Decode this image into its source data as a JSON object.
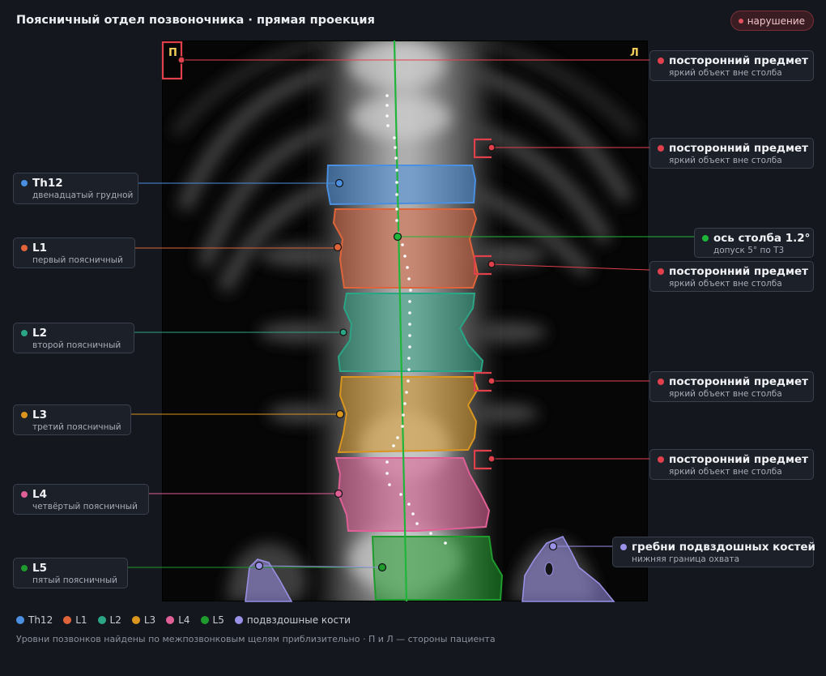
{
  "header": {
    "title": "Поясничный отдел позвоночника · прямая проекция",
    "badge": "нарушение"
  },
  "image": {
    "side_right_letter": "П",
    "side_left_letter": "Л"
  },
  "colors": {
    "th12": "#4a8fe0",
    "l1": "#e0643a",
    "l2": "#2aa585",
    "l3": "#d9951e",
    "l4": "#df5f96",
    "l5": "#1f9a2c",
    "iliac": "#9a92e8",
    "foreign": "#e0404c",
    "axis": "#1fb53a",
    "badge": "#e0525e"
  },
  "vertebrae": [
    {
      "key": "th12",
      "name": "Th12",
      "desc": "двенадцатый грудной"
    },
    {
      "key": "l1",
      "name": "L1",
      "desc": "первый поясничный"
    },
    {
      "key": "l2",
      "name": "L2",
      "desc": "второй поясничный"
    },
    {
      "key": "l3",
      "name": "L3",
      "desc": "третий поясничный"
    },
    {
      "key": "l4",
      "name": "L4",
      "desc": "четвёртый поясничный"
    },
    {
      "key": "l5",
      "name": "L5",
      "desc": "пятый поясничный"
    }
  ],
  "foreign_objects": [
    {
      "name": "посторонний предмет",
      "desc": "яркий объект вне столба"
    },
    {
      "name": "посторонний предмет",
      "desc": "яркий объект вне столба"
    },
    {
      "name": "посторонний предмет",
      "desc": "яркий объект вне столба"
    },
    {
      "name": "посторонний предмет",
      "desc": "яркий объект вне столба"
    },
    {
      "name": "посторонний предмет",
      "desc": "яркий объект вне столба"
    }
  ],
  "axis": {
    "name": "ось столба 1.2°",
    "desc": "допуск 5° по Т3"
  },
  "iliac": {
    "name": "гребни подвздошных костей",
    "desc": "нижняя граница охвата"
  },
  "legend": [
    {
      "label": "Th12",
      "color": "#4a8fe0"
    },
    {
      "label": "L1",
      "color": "#e0643a"
    },
    {
      "label": "L2",
      "color": "#2aa585"
    },
    {
      "label": "L3",
      "color": "#d9951e"
    },
    {
      "label": "L4",
      "color": "#df5f96"
    },
    {
      "label": "L5",
      "color": "#1f9a2c"
    },
    {
      "label": "подвздошные кости",
      "color": "#9a92e8"
    }
  ],
  "footnote": "Уровни позвонков найдены по межпозвонковым щелям приблизительно · П и Л — стороны пациента"
}
